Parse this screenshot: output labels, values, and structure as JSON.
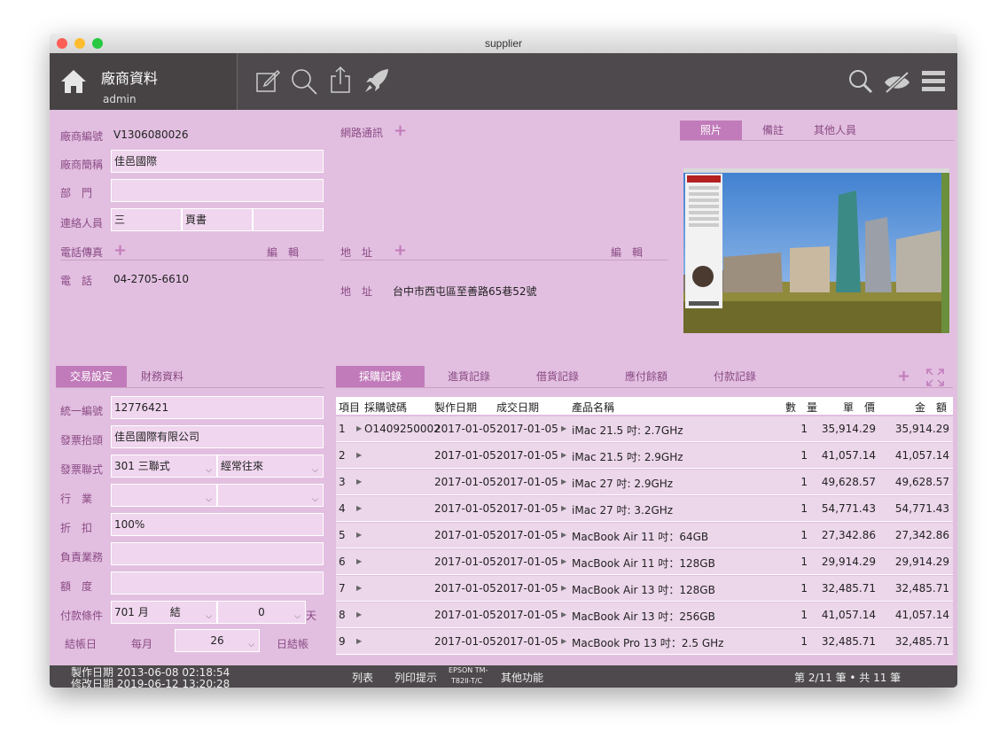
{
  "window": {
    "title": "supplier"
  },
  "brand": {
    "title": "廠商資料",
    "user": "admin"
  },
  "vendor": {
    "id_label": "廠商編號",
    "id_value": "V1306080026",
    "short_label": "廠商簡稱",
    "short_value": "佳邑國際",
    "dept_label": "部　門",
    "dept_value": "",
    "contact_label": "連絡人員",
    "contact_name": "三",
    "contact_title": "頁書",
    "contact_extra": "",
    "phone_section": "電話傳真",
    "edit": "編　輯",
    "phone_label": "電　話",
    "phone_value": "04-2705-6610"
  },
  "network": {
    "label": "網路通訊"
  },
  "address": {
    "section": "地　址",
    "edit": "編　輯",
    "label": "地　址",
    "value": "台中市西屯區至善路65巷52號"
  },
  "photo_tabs": [
    "照片",
    "備註",
    "其他人員"
  ],
  "settings_tabs": [
    "交易設定",
    "財務資料"
  ],
  "settings": {
    "tax_label": "統一編號",
    "tax_value": "12776421",
    "invoice_title_label": "發票抬頭",
    "invoice_title_value": "佳邑國際有限公司",
    "invoice_type_label": "發票聯式",
    "invoice_type_value": "301 三聯式",
    "invoice_freq_value": "經常往來",
    "industry_label": "行　業",
    "industry_value1": "",
    "industry_value2": "",
    "discount_label": "折　扣",
    "discount_value": "100%",
    "owner_label": "負責業務",
    "owner_value": "",
    "credit_label": "額　度",
    "credit_value": "",
    "payment_label": "付款條件",
    "payment_value": "701 月　　結",
    "payment_days": "0",
    "payment_days_unit": "天",
    "closing_label": "結帳日",
    "closing_monthly": "每月",
    "closing_day": "26",
    "closing_suffix": "日結帳"
  },
  "record_tabs": [
    "採購記錄",
    "進貨記錄",
    "借貨記錄",
    "應付餘額",
    "付款記錄"
  ],
  "table": {
    "headers": [
      "項目",
      "採購號碼",
      "製作日期",
      "成交日期",
      "產品名稱",
      "數　量",
      "單　價",
      "金　額"
    ],
    "rows": [
      {
        "idx": "1",
        "po": "O1409250002",
        "made": "2017-01-05",
        "deal": "2017-01-05",
        "product": "iMac 21.5 吋: 2.7GHz",
        "qty": "1",
        "price": "35,914.29",
        "amount": "35,914.29"
      },
      {
        "idx": "2",
        "po": "",
        "made": "2017-01-05",
        "deal": "2017-01-05",
        "product": "iMac 21.5 吋: 2.9GHz",
        "qty": "1",
        "price": "41,057.14",
        "amount": "41,057.14"
      },
      {
        "idx": "3",
        "po": "",
        "made": "2017-01-05",
        "deal": "2017-01-05",
        "product": "iMac 27 吋: 2.9GHz",
        "qty": "1",
        "price": "49,628.57",
        "amount": "49,628.57"
      },
      {
        "idx": "4",
        "po": "",
        "made": "2017-01-05",
        "deal": "2017-01-05",
        "product": "iMac 27 吋: 3.2GHz",
        "qty": "1",
        "price": "54,771.43",
        "amount": "54,771.43"
      },
      {
        "idx": "5",
        "po": "",
        "made": "2017-01-05",
        "deal": "2017-01-05",
        "product": "MacBook Air 11 吋：64GB",
        "qty": "1",
        "price": "27,342.86",
        "amount": "27,342.86"
      },
      {
        "idx": "6",
        "po": "",
        "made": "2017-01-05",
        "deal": "2017-01-05",
        "product": "MacBook Air 11 吋：128GB",
        "qty": "1",
        "price": "29,914.29",
        "amount": "29,914.29"
      },
      {
        "idx": "7",
        "po": "",
        "made": "2017-01-05",
        "deal": "2017-01-05",
        "product": "MacBook Air 13 吋：128GB",
        "qty": "1",
        "price": "32,485.71",
        "amount": "32,485.71"
      },
      {
        "idx": "8",
        "po": "",
        "made": "2017-01-05",
        "deal": "2017-01-05",
        "product": "MacBook Air 13 吋：256GB",
        "qty": "1",
        "price": "41,057.14",
        "amount": "41,057.14"
      },
      {
        "idx": "9",
        "po": "",
        "made": "2017-01-05",
        "deal": "2017-01-05",
        "product": "MacBook Pro 13 吋：2.5 GHz",
        "qty": "1",
        "price": "32,485.71",
        "amount": "32,485.71"
      }
    ]
  },
  "status": {
    "created": "製作日期 2013-06-08 02:18:54",
    "modified": "修改日期 2019-06-12 13:20:28",
    "list": "列表",
    "print_hint": "列印提示",
    "printer_line1": "EPSON TM-",
    "printer_line2": "T82II-T/C",
    "other": "其他功能",
    "record_count": "第 2/11 筆 • 共 11 筆"
  },
  "icons": [
    "home-icon",
    "edit-icon",
    "search-icon",
    "share-icon",
    "rocket-icon",
    "find-icon",
    "hide-icon",
    "menu-icon"
  ],
  "colors": {
    "background": "#e2bfe0",
    "toolbar": "#4d494c",
    "accent": "#c17bba",
    "label": "#8a4a85"
  }
}
